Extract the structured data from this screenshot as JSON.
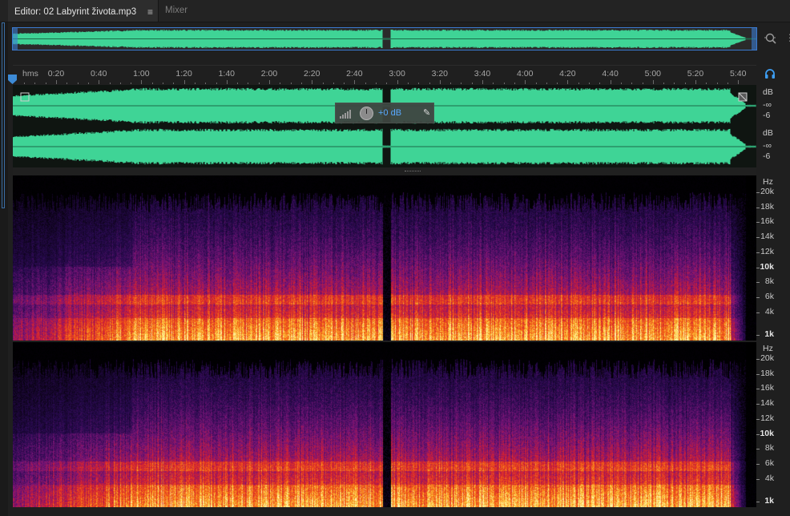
{
  "tabs": {
    "editor_label": "Editor: 02 Labyrint života.mp3",
    "menu_icon": "≡",
    "mixer_label": "Mixer"
  },
  "timeline": {
    "unit_label": "hms",
    "ticks": [
      "0:20",
      "0:40",
      "1:00",
      "1:20",
      "1:40",
      "2:00",
      "2:20",
      "2:40",
      "3:00",
      "3:20",
      "3:40",
      "4:00",
      "4:20",
      "4:40",
      "5:00",
      "5:20",
      "5:40"
    ]
  },
  "waveform": {
    "color": "#3fd496",
    "channel1": {
      "db_label": "dB",
      "inf_label": "-∞",
      "minus6_label": "-6"
    },
    "channel2": {
      "db_label": "dB",
      "inf_label": "-∞",
      "minus6_label": "-6"
    }
  },
  "hud": {
    "gain_label": "+0 dB"
  },
  "spectral": {
    "unit_label": "Hz",
    "channel1_labels": [
      "20k",
      "18k",
      "16k",
      "14k",
      "12k",
      "10k",
      "8k",
      "6k",
      "4k",
      "1k"
    ],
    "channel2_labels": [
      "20k",
      "18k",
      "16k",
      "14k",
      "12k",
      "10k",
      "8k",
      "6k",
      "4k",
      "1k"
    ]
  },
  "icons": {
    "zoom": "zoom-icon",
    "headphones": "headphones-icon",
    "pin": "pin-icon",
    "playhead": "playhead-icon",
    "knob": "gain-knob-icon"
  }
}
